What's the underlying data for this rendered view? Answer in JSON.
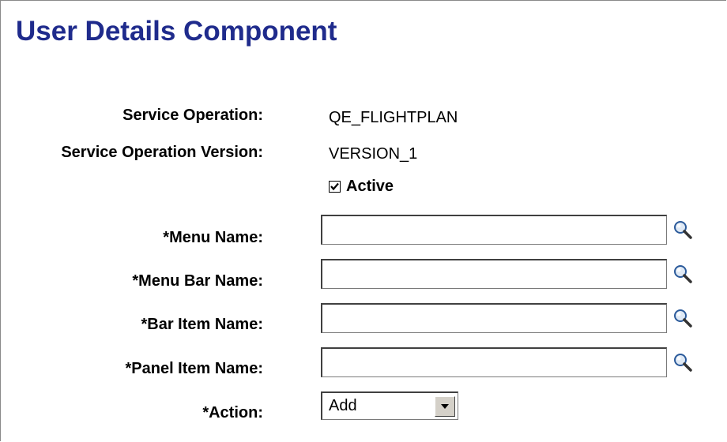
{
  "page": {
    "title": "User Details Component"
  },
  "service_operation": {
    "label": "Service Operation:",
    "value": "QE_FLIGHTPLAN"
  },
  "service_operation_version": {
    "label": "Service Operation Version:",
    "value": "VERSION_1"
  },
  "active": {
    "label": "Active",
    "checked": true
  },
  "fields": {
    "menu_name": {
      "label": "*Menu Name:",
      "value": ""
    },
    "menu_bar_name": {
      "label": "*Menu Bar Name:",
      "value": ""
    },
    "bar_item_name": {
      "label": "*Bar Item Name:",
      "value": ""
    },
    "panel_item_name": {
      "label": "*Panel Item Name:",
      "value": ""
    }
  },
  "action": {
    "label": "*Action:",
    "selected": "Add"
  },
  "icons": {
    "lookup": "magnifying-glass-icon",
    "dropdown": "triangle-down-icon",
    "checkmark": "checkmark-icon"
  },
  "colors": {
    "title": "#1f2b8c",
    "lookup_lens": "#5a8fcf"
  }
}
